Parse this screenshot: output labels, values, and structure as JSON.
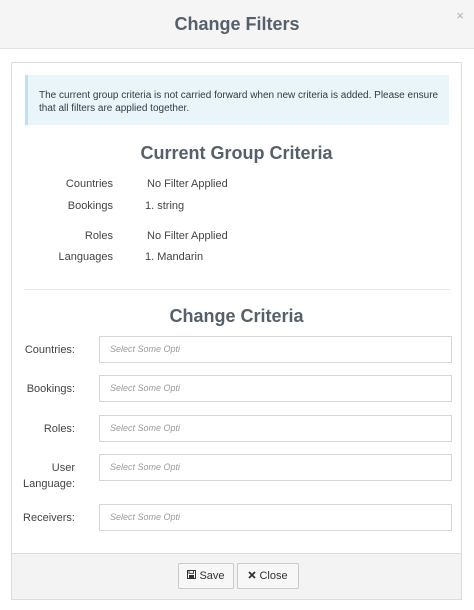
{
  "modal": {
    "title": "Change Filters",
    "close_glyph": "×"
  },
  "alert": {
    "text": "The current group criteria is not carried forward when new criteria is added. Please ensure that all filters are applied together."
  },
  "current_criteria": {
    "title": "Current Group Criteria",
    "rows": [
      {
        "label": "Countries",
        "value": "No Filter Applied"
      },
      {
        "label": "Bookings",
        "value": "1. string"
      },
      {
        "label": "Roles",
        "value": "No Filter Applied"
      },
      {
        "label": "Languages",
        "value": "1. Mandarin"
      }
    ]
  },
  "change_criteria": {
    "title": "Change Criteria",
    "fields": [
      {
        "label": "Countries:",
        "placeholder": "Select Some Opti"
      },
      {
        "label": "Bookings:",
        "placeholder": "Select Some Opti"
      },
      {
        "label": "Roles:",
        "placeholder": "Select Some Opti"
      },
      {
        "label": "User Language:",
        "placeholder": "Select Some Opti"
      },
      {
        "label": "Receivers:",
        "placeholder": "Select Some Opti"
      }
    ]
  },
  "footer": {
    "save_label": "Save",
    "save_icon": "floppy-disk-icon",
    "close_label": "Close",
    "close_icon": "times-icon"
  }
}
